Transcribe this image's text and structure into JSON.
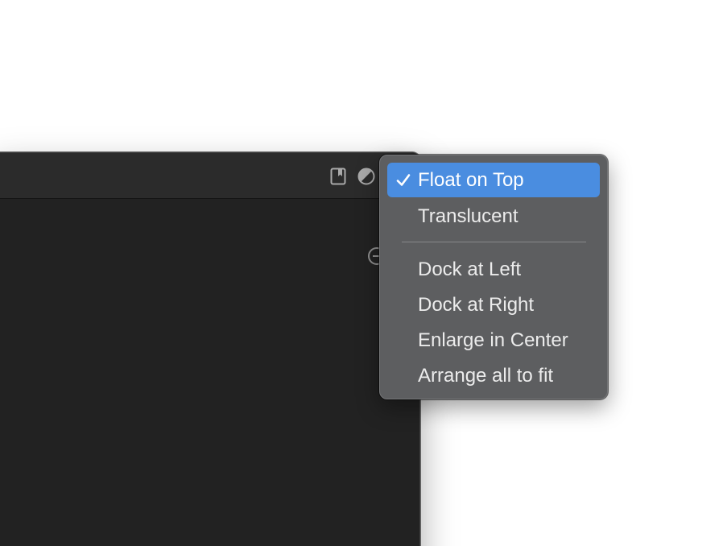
{
  "window": {
    "toolbar_icons": [
      "bookmark-icon",
      "contrast-icon"
    ],
    "side_icon": "circle-plus-icon"
  },
  "menu": {
    "items": [
      {
        "label": "Float on Top",
        "checked": true,
        "highlighted": true
      },
      {
        "label": "Translucent",
        "checked": false,
        "highlighted": false
      },
      {
        "label": "Dock at Left",
        "checked": false,
        "highlighted": false
      },
      {
        "label": "Dock at Right",
        "checked": false,
        "highlighted": false
      },
      {
        "label": "Enlarge in Center",
        "checked": false,
        "highlighted": false
      },
      {
        "label": "Arrange all to fit",
        "checked": false,
        "highlighted": false
      }
    ],
    "check_glyph": "✓",
    "colors": {
      "menu_background": "#5d5e60",
      "highlight": "#4a8de0",
      "text": "#ececec",
      "window_background": "#222222"
    }
  }
}
